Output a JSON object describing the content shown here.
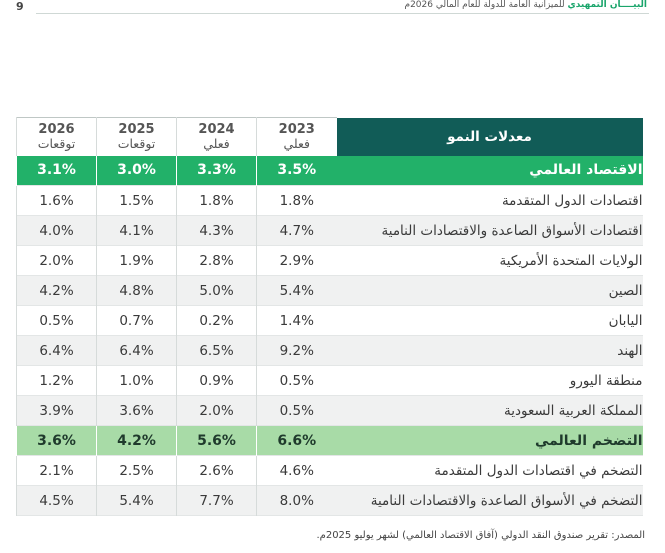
{
  "header": {
    "page_number": "9",
    "accent_text": "البيــــان التمهيدي",
    "rest_text": "للميزانية العامة للدولة للعام المالي 2026م"
  },
  "table": {
    "title": "معدلات النمو",
    "columns": [
      {
        "year": "2023",
        "status": "فعلي"
      },
      {
        "year": "2024",
        "status": "فعلي"
      },
      {
        "year": "2025",
        "status": "توقعات"
      },
      {
        "year": "2026",
        "status": "توقعات"
      }
    ],
    "rows": [
      {
        "label": "الاقتصاد العالمي",
        "style": "band-strong",
        "values": [
          "3.5%",
          "3.3%",
          "3.0%",
          "3.1%"
        ]
      },
      {
        "label": "اقتصادات الدول المتقدمة",
        "style": "zebra-0",
        "values": [
          "1.8%",
          "1.8%",
          "1.5%",
          "1.6%"
        ]
      },
      {
        "label": "اقتصادات الأسواق الصاعدة والاقتصادات النامية",
        "style": "zebra-1",
        "values": [
          "4.7%",
          "4.3%",
          "4.1%",
          "4.0%"
        ]
      },
      {
        "label": "الولايات المتحدة الأمريكية",
        "style": "zebra-0",
        "values": [
          "2.9%",
          "2.8%",
          "1.9%",
          "2.0%"
        ]
      },
      {
        "label": "الصين",
        "style": "zebra-1",
        "values": [
          "5.4%",
          "5.0%",
          "4.8%",
          "4.2%"
        ]
      },
      {
        "label": "اليابان",
        "style": "zebra-0",
        "values": [
          "1.4%",
          "0.2%",
          "0.7%",
          "0.5%"
        ]
      },
      {
        "label": "الهند",
        "style": "zebra-1",
        "values": [
          "9.2%",
          "6.5%",
          "6.4%",
          "6.4%"
        ]
      },
      {
        "label": "منطقة اليورو",
        "style": "zebra-0",
        "values": [
          "0.5%",
          "0.9%",
          "1.0%",
          "1.2%"
        ]
      },
      {
        "label": "المملكة العربية السعودية",
        "style": "zebra-1",
        "values": [
          "0.5%",
          "2.0%",
          "3.6%",
          "3.9%"
        ]
      },
      {
        "label": "التضخم العالمي",
        "style": "band-light",
        "values": [
          "6.6%",
          "5.6%",
          "4.2%",
          "3.6%"
        ]
      },
      {
        "label": "التضخم في اقتصادات الدول المتقدمة",
        "style": "zebra-0",
        "values": [
          "4.6%",
          "2.6%",
          "2.5%",
          "2.1%"
        ]
      },
      {
        "label": "التضخم في الأسواق الصاعدة والاقتصادات النامية",
        "style": "zebra-1",
        "values": [
          "8.0%",
          "7.7%",
          "5.4%",
          "4.5%"
        ]
      }
    ]
  },
  "source": "المصدر: تقرير صندوق النقد الدولي (آفاق الاقتصاد العالمي) لشهر يوليو 2025م."
}
